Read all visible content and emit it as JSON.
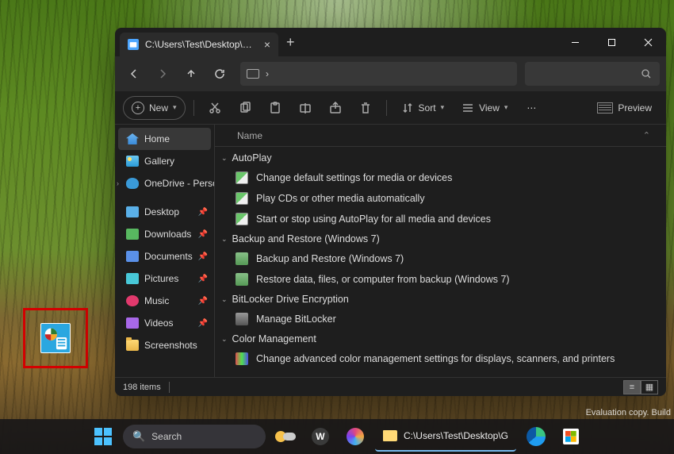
{
  "desktop": {
    "watermark": "Evaluation copy. Build"
  },
  "explorer": {
    "tab_title": "C:\\Users\\Test\\Desktop\\GodMo",
    "address_chevron": "›",
    "toolbar": {
      "new": "New",
      "sort": "Sort",
      "view": "View",
      "preview": "Preview"
    },
    "sidebar": {
      "home": "Home",
      "gallery": "Gallery",
      "onedrive": "OneDrive - Perso",
      "desktop": "Desktop",
      "downloads": "Downloads",
      "documents": "Documents",
      "pictures": "Pictures",
      "music": "Music",
      "videos": "Videos",
      "screenshots": "Screenshots"
    },
    "columns": {
      "name": "Name"
    },
    "groups": [
      {
        "label": "AutoPlay",
        "items": [
          "Change default settings for media or devices",
          "Play CDs or other media automatically",
          "Start or stop using AutoPlay for all media and devices"
        ]
      },
      {
        "label": "Backup and Restore (Windows 7)",
        "items": [
          "Backup and Restore (Windows 7)",
          "Restore data, files, or computer from backup (Windows 7)"
        ]
      },
      {
        "label": "BitLocker Drive Encryption",
        "items": [
          "Manage BitLocker"
        ]
      },
      {
        "label": "Color Management",
        "items": [
          "Change advanced color management settings for displays, scanners, and printers"
        ]
      }
    ],
    "status": {
      "count": "198 items"
    }
  },
  "taskbar": {
    "search_placeholder": "Search",
    "running_title": "C:\\Users\\Test\\Desktop\\G",
    "word_glyph": "W"
  }
}
